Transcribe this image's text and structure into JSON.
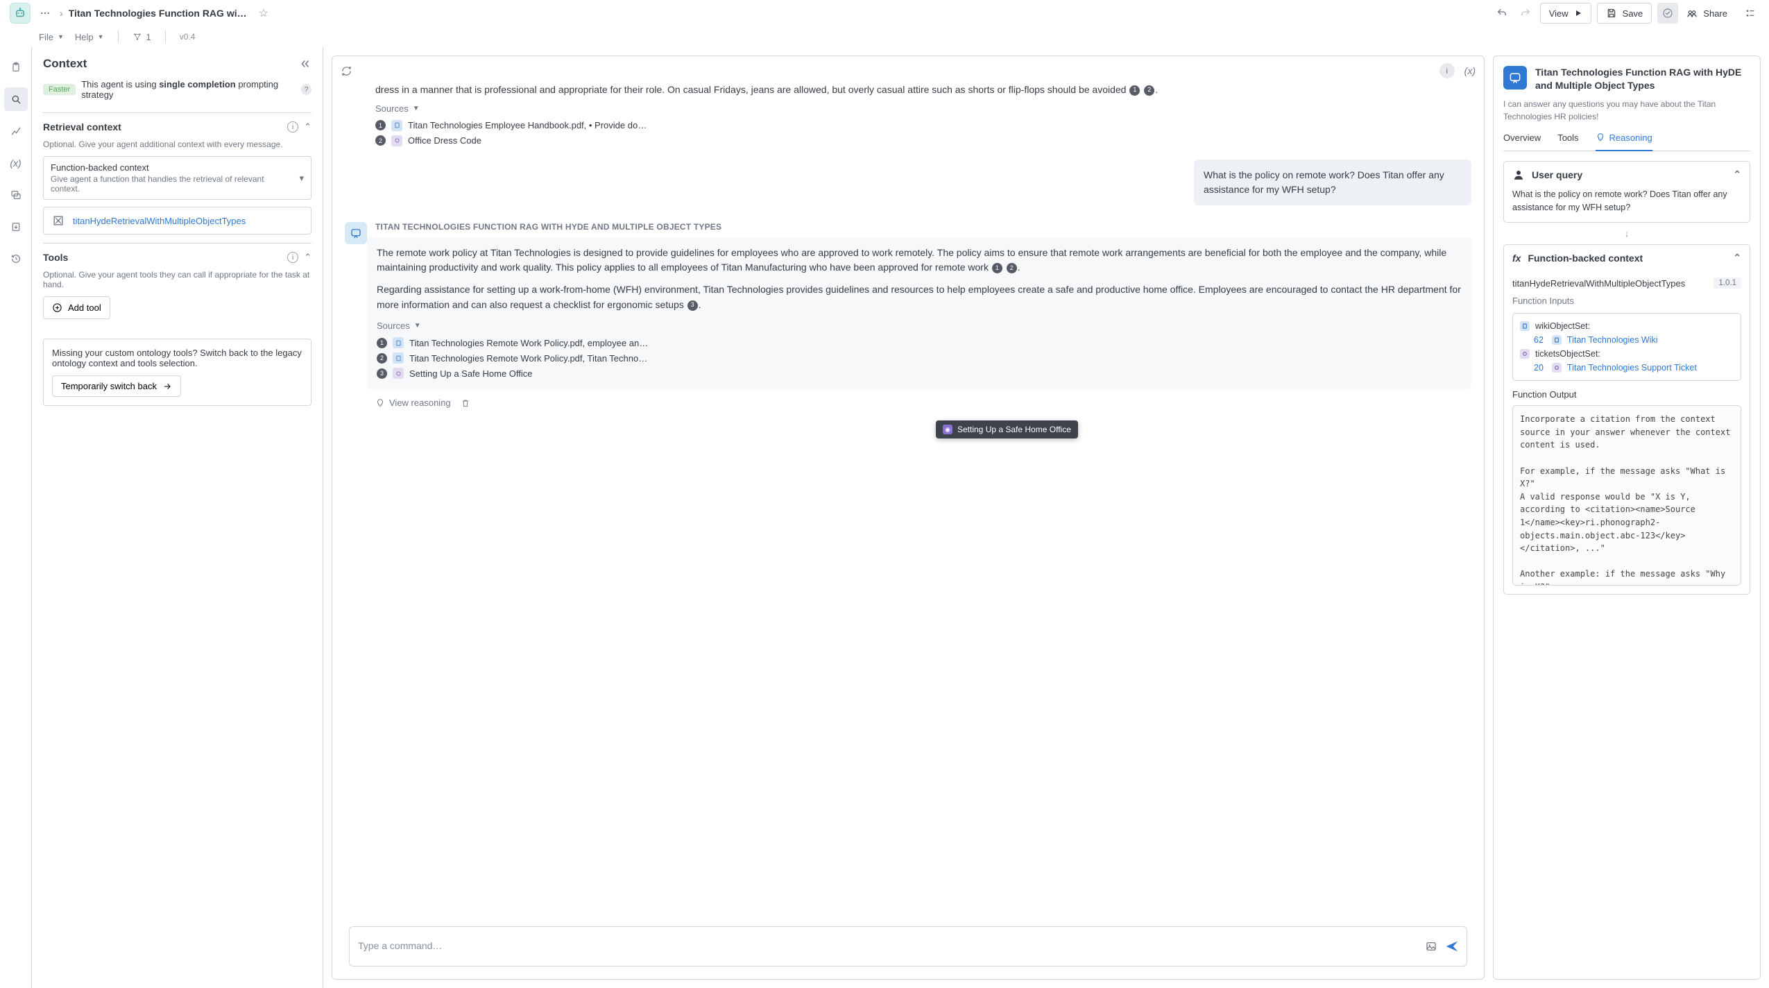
{
  "header": {
    "title": "Titan Technologies Function RAG with …",
    "undo": "Undo",
    "redo": "Redo",
    "view": "View",
    "save": "Save",
    "share": "Share"
  },
  "menubar": {
    "file": "File",
    "help": "Help",
    "graph_count": "1",
    "version": "v0.4"
  },
  "context_panel": {
    "title": "Context",
    "faster_badge": "Faster",
    "strategy_prefix": "This agent is using ",
    "strategy_strong": "single completion",
    "strategy_suffix": " prompting strategy",
    "retrieval_title": "Retrieval context",
    "retrieval_hint": "Optional. Give your agent additional context with every message.",
    "fn_backed_title": "Function-backed context",
    "fn_backed_sub": "Give agent a function that handles the retrieval of relevant context.",
    "fn_name": "titanHydeRetrievalWithMultipleObjectTypes",
    "tools_title": "Tools",
    "tools_hint": "Optional. Give your agent tools they can call if appropriate for the task at hand.",
    "add_tool": "Add tool",
    "legacy_text": "Missing your custom ontology tools? Switch back to the legacy ontology context and tools selection.",
    "legacy_btn": "Temporarily switch back"
  },
  "conversation": {
    "prev_partial": "dress in a manner that is professional and appropriate for their role. On casual Fridays, jeans are allowed, but overly casual attire such as shorts or flip-flops should be avoided ",
    "sources_label": "Sources",
    "prev_sources": [
      {
        "num": "1",
        "icon": "blue",
        "text": "Titan Technologies Employee Handbook.pdf, • Provide do…"
      },
      {
        "num": "2",
        "icon": "purple",
        "text": "Office Dress Code"
      }
    ],
    "user_query": "What is the policy on remote work? Does Titan offer any assistance for my WFH setup?",
    "asst_name": "TITAN TECHNOLOGIES FUNCTION RAG WITH HYDE AND MULTIPLE OBJECT TYPES",
    "answer_p1": "The remote work policy at Titan Technologies is designed to provide guidelines for employees who are approved to work remotely. The policy aims to ensure that remote work arrangements are beneficial for both the employee and the company, while maintaining productivity and work quality. This policy applies to all employees of Titan Manufacturing who have been approved for remote work ",
    "answer_p2": "Regarding assistance for setting up a work-from-home (WFH) environment, Titan Technologies provides guidelines and resources to help employees create a safe and productive home office. Employees are encouraged to contact the HR department for more information and can also request a checklist for ergonomic setups ",
    "answer_sources": [
      {
        "num": "1",
        "icon": "blue",
        "text": "Titan Technologies Remote Work Policy.pdf, employee an…"
      },
      {
        "num": "2",
        "icon": "blue",
        "text": "Titan Technologies Remote Work Policy.pdf, Titan Techno…"
      },
      {
        "num": "3",
        "icon": "purple",
        "text": "Setting Up a Safe Home Office"
      }
    ],
    "view_reasoning": "View reasoning",
    "placeholder": "Type a command…"
  },
  "tooltip": {
    "label": "Setting Up a Safe Home Office"
  },
  "reasoning": {
    "title": "Titan Technologies Function RAG with HyDE and Multiple Object Types",
    "desc": "I can answer any questions you may have about the Titan Technologies HR policies!",
    "tabs": {
      "overview": "Overview",
      "tools": "Tools",
      "reasoning": "Reasoning"
    },
    "user_query_label": "User query",
    "user_query_text": "What is the policy on remote work? Does Titan offer any assistance for my WFH setup?",
    "fbc_label": "Function-backed context",
    "fn_name": "titanHydeRetrievalWithMultipleObjectTypes",
    "fn_version": "1.0.1",
    "fn_inputs_label": "Function Inputs",
    "input_wiki_key": "wikiObjectSet:",
    "input_wiki_count": "62",
    "input_wiki_link": "Titan Technologies Wiki",
    "input_tickets_key": "ticketsObjectSet:",
    "input_tickets_count": "20",
    "input_tickets_link": "Titan Technologies Support Ticket",
    "fn_output_label": "Function Output",
    "fn_output_text": "Incorporate a citation from the context source in your answer whenever the context content is used.\n\nFor example, if the message asks \"What is X?\"\nA valid response would be \"X is Y, according to <citation><name>Source 1</name><key>ri.phonograph2-objects.main.object.abc-123</key></citation>, ...\"\n\nAnother example: if the message asks \"Why is X?\"\nA valid response would be: \"X is Y because ...\"\nFor more details or further clarification, ple"
  }
}
